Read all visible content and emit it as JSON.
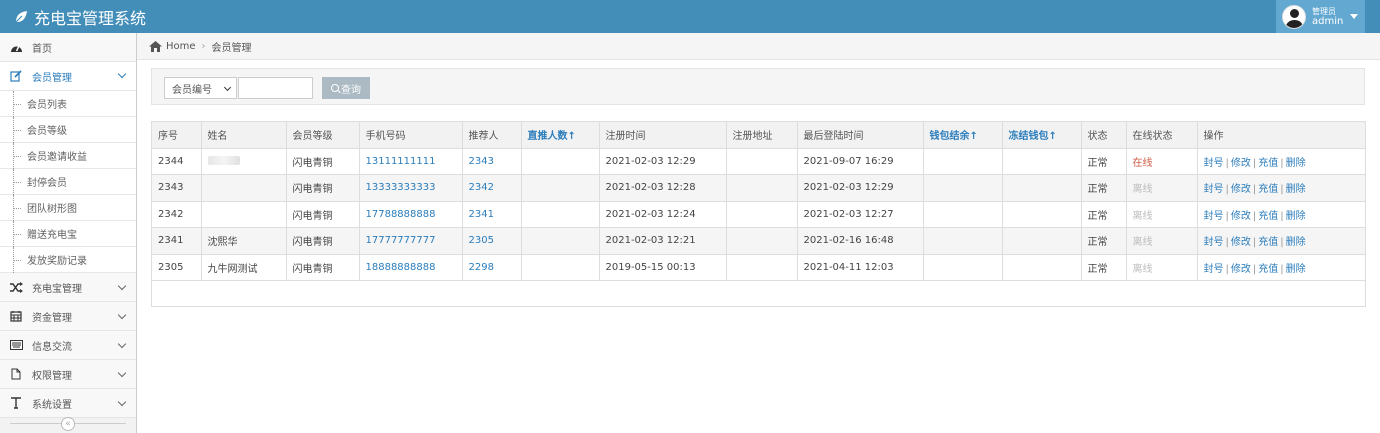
{
  "app": {
    "title": "充电宝管理系统"
  },
  "user": {
    "role": "管理员",
    "name": "admin"
  },
  "sidebar": {
    "items": [
      {
        "label": "首页",
        "icon": "dashboard-icon"
      },
      {
        "label": "会员管理",
        "icon": "edit-icon",
        "active": true
      },
      {
        "label": "充电宝管理",
        "icon": "shuffle-icon"
      },
      {
        "label": "资金管理",
        "icon": "calendar-icon"
      },
      {
        "label": "信息交流",
        "icon": "keyboard-icon"
      },
      {
        "label": "权限管理",
        "icon": "file-icon"
      },
      {
        "label": "系统设置",
        "icon": "text-icon"
      }
    ],
    "sub_items": [
      "会员列表",
      "会员等级",
      "会员邀请收益",
      "封停会员",
      "团队树形图",
      "赠送充电宝",
      "发放奖励记录"
    ]
  },
  "breadcrumb": {
    "home": "Home",
    "current": "会员管理"
  },
  "search": {
    "select_value": "会员编号",
    "input_value": "",
    "button_label": "查询"
  },
  "table": {
    "headers": [
      "序号",
      "姓名",
      "会员等级",
      "手机号码",
      "推荐人",
      "直推人数↑",
      "注册时间",
      "注册地址",
      "最后登陆时间",
      "钱包结余↑",
      "冻结钱包↑",
      "状态",
      "在线状态",
      "操作"
    ],
    "rows": [
      [
        "2344",
        "",
        "闪电青铜",
        "13111111111",
        "2343",
        "",
        "2021-02-03 12:29",
        "",
        "2021-09-07 16:29",
        "",
        "",
        "正常",
        "在线"
      ],
      [
        "2343",
        "",
        "闪电青铜",
        "13333333333",
        "2342",
        "",
        "2021-02-03 12:28",
        "",
        "2021-02-03 12:29",
        "",
        "",
        "正常",
        "离线"
      ],
      [
        "2342",
        "",
        "闪电青铜",
        "17788888888",
        "2341",
        "",
        "2021-02-03 12:24",
        "",
        "2021-02-03 12:27",
        "",
        "",
        "正常",
        "离线"
      ],
      [
        "2341",
        "沈熙华",
        "闪电青铜",
        "17777777777",
        "2305",
        "",
        "2021-02-03 12:21",
        "",
        "2021-02-16 16:48",
        "",
        "",
        "正常",
        "离线"
      ],
      [
        "2305",
        "九牛网测试",
        "闪电青铜",
        "18888888888",
        "2298",
        "",
        "2019-05-15 00:13",
        "",
        "2021-04-11 12:03",
        "",
        "",
        "正常",
        "离线"
      ]
    ],
    "ops": [
      "封号",
      "修改",
      "充值",
      "删除"
    ]
  },
  "colors": {
    "header": "#438eb9",
    "link": "#2b7dbc",
    "online": "#d15b47"
  }
}
